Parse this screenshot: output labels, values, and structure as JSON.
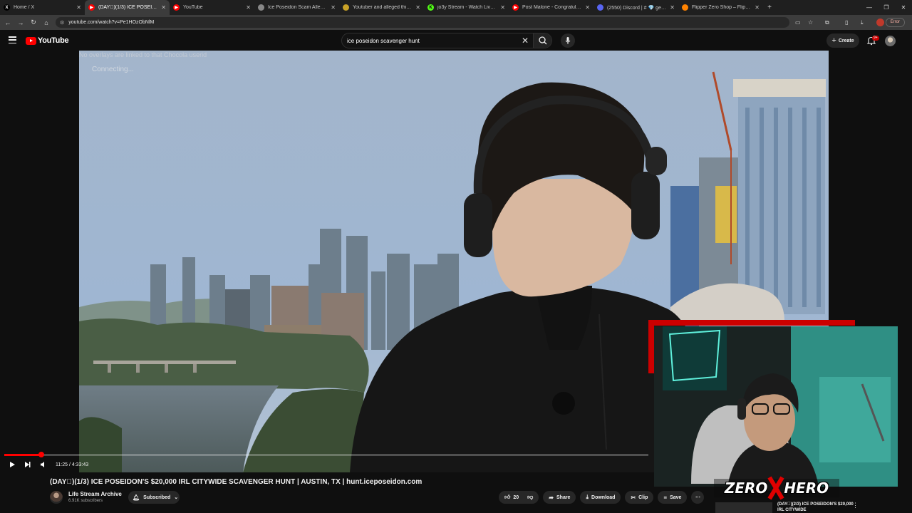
{
  "browser": {
    "tabs": [
      {
        "title": "Home / X",
        "favicon": "x-logo-icon",
        "favicon_color": "#000000"
      },
      {
        "title": "(DAY⃣)(1/3) ICE POSEIDON'S $",
        "favicon": "youtube-icon",
        "favicon_color": "#ff0000",
        "active": true
      },
      {
        "title": "YouTube",
        "favicon": "youtube-icon",
        "favicon_color": "#ff0000"
      },
      {
        "title": "Ice Poseidon Scam Allegations",
        "favicon": "globe-icon",
        "favicon_color": "#888888"
      },
      {
        "title": "Youtuber and alleged thief pul",
        "favicon": "news-icon",
        "favicon_color": "#c9a227"
      },
      {
        "title": "jo3y Stream - Watch Live on Ki",
        "favicon": "kick-icon",
        "favicon_color": "#53fc18"
      },
      {
        "title": "Post Malone - Congratulation",
        "favicon": "youtube-icon",
        "favicon_color": "#ff0000"
      },
      {
        "title": "(2550) Discord | # 💎 general |",
        "favicon": "discord-icon",
        "favicon_color": "#5865f2"
      },
      {
        "title": "Flipper Zero Shop – Flipper Sh",
        "favicon": "flipper-icon",
        "favicon_color": "#ff8200"
      }
    ],
    "new_tab_label": "+",
    "url": "youtube.com/watch?v=Pe1HOzObNlM",
    "error_label": "Error",
    "profile_letter": "J"
  },
  "youtube": {
    "logo_text": "YouTube",
    "search_value": "ice poseidon scavenger hunt",
    "create_label": "Create",
    "notification_count": "9+"
  },
  "player": {
    "overlay_text": "No overlays are linked to that Chocola userid",
    "connecting_text": "Connecting...",
    "time_label": "11:25 / 4:33:43",
    "progress_fraction": 0.058
  },
  "video": {
    "title": "(DAY⃣)(1/3) ICE POSEIDON'S $20,000 IRL CITYWIDE SCAVENGER HUNT | AUSTIN, TX | hunt.iceposeidon.com",
    "channel_name": "Life Stream Archive",
    "subscribers": "6.91K subscribers",
    "subscribe_label": "Subscribed",
    "like_count": "20",
    "share_label": "Share",
    "download_label": "Download",
    "clip_label": "Clip",
    "save_label": "Save"
  },
  "pip": {
    "logo_text": "ZERO HERO"
  },
  "suggested": {
    "title": "(DAY⃣)(2/3) ICE POSEIDON'S $20,000 IRL CITYWIDE"
  },
  "colors": {
    "brand_red": "#ff0000",
    "background": "#0f0f0f",
    "pill": "#272727"
  }
}
